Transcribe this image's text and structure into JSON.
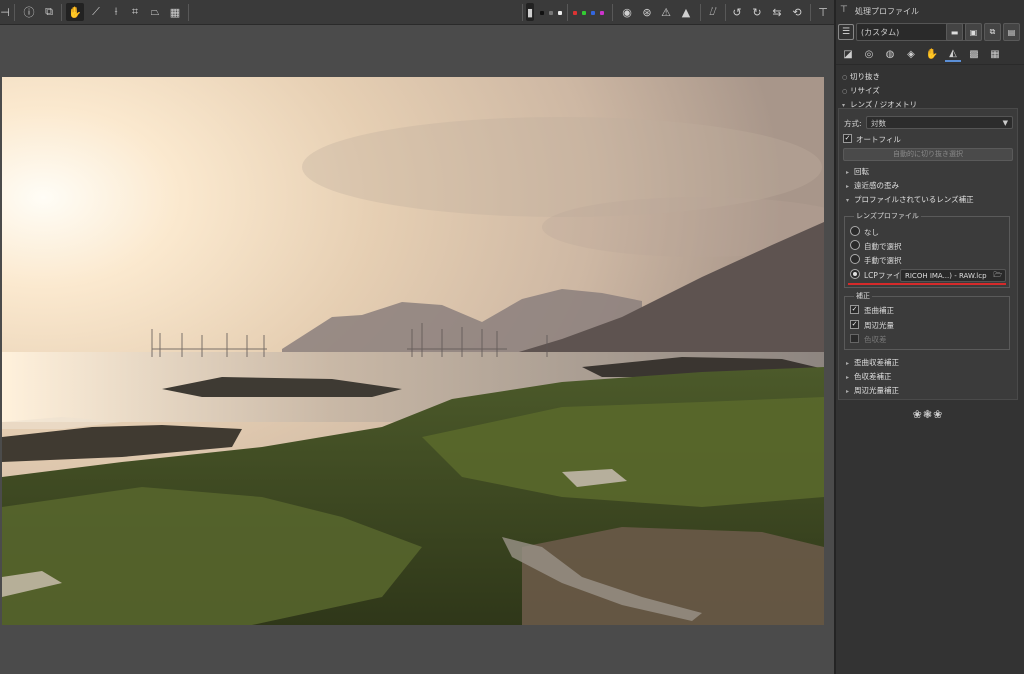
{
  "toolbar": {
    "icons": [
      "info-icon",
      "layers-icon",
      "hand-icon",
      "eyedropper-icon",
      "straighten-icon",
      "crop-icon",
      "perspective-icon",
      "grid-icon",
      "clipping-warning-icon",
      "histogram-icon",
      "rotate-left-icon",
      "rotate-right-icon",
      "flip-horizontal-icon",
      "flip-vertical-icon",
      "tune-icon"
    ],
    "preview_modes": [
      "R",
      "G",
      "B",
      "L"
    ]
  },
  "panel": {
    "title": "処理プロファイル",
    "profile_value": "(カスタム)",
    "sections": {
      "crop": "切り抜き",
      "resize": "リサイズ",
      "lens_geometry": "レンズ / ジオメトリ"
    },
    "method_label": "方式:",
    "method_value": "対数",
    "autofill_label": "オートフィル",
    "autocrop_button": "自動的に切り抜き選択",
    "subsections": {
      "rotate": "回転",
      "perspective": "遠近感の歪み",
      "profiled_correction": "プロファイルされているレンズ補正"
    },
    "lens_profile": {
      "legend": "レンズプロファイル",
      "options": [
        "なし",
        "自動で選択",
        "手動で選択"
      ],
      "lcp_label": "LCPファイル",
      "lcp_value": "RICOH IMA...) - RAW.lcp"
    },
    "correction": {
      "legend": "補正",
      "distortion": "歪曲補正",
      "vignetting": "周辺光量",
      "ca": "色収差"
    },
    "more": {
      "distortion_correction": "歪曲収差補正",
      "ca_correction": "色収差補正",
      "vignetting_correction": "周辺光量補正"
    },
    "ornament": "❀❃❀"
  },
  "colors": {
    "accent": "#5b8fd6",
    "highlight_underline": "#d62a2a",
    "panel_bg": "#333333",
    "canvas_bg": "#4b4b4b"
  }
}
